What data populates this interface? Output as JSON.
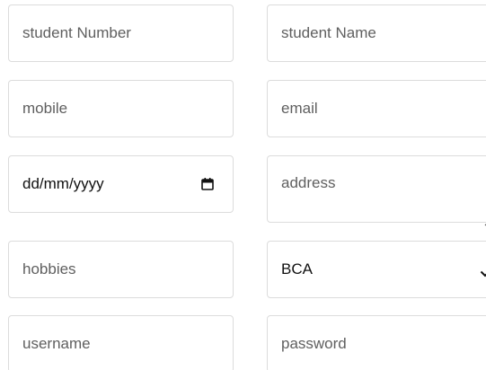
{
  "form": {
    "student_number": {
      "placeholder": "student Number"
    },
    "student_name": {
      "placeholder": "student Name"
    },
    "mobile": {
      "placeholder": "mobile"
    },
    "email": {
      "placeholder": "email"
    },
    "date": {
      "value": "dd/mm/yyyy",
      "icon": "calendar-icon"
    },
    "address": {
      "placeholder": "address"
    },
    "hobbies": {
      "placeholder": "hobbies"
    },
    "course": {
      "selected": "BCA",
      "icon": "chevron-down-icon"
    },
    "username": {
      "placeholder": "username"
    },
    "password": {
      "placeholder": "password"
    }
  },
  "colors": {
    "border": "#dcdcdc",
    "placeholder": "#5f5f5f",
    "text": "#111111"
  }
}
